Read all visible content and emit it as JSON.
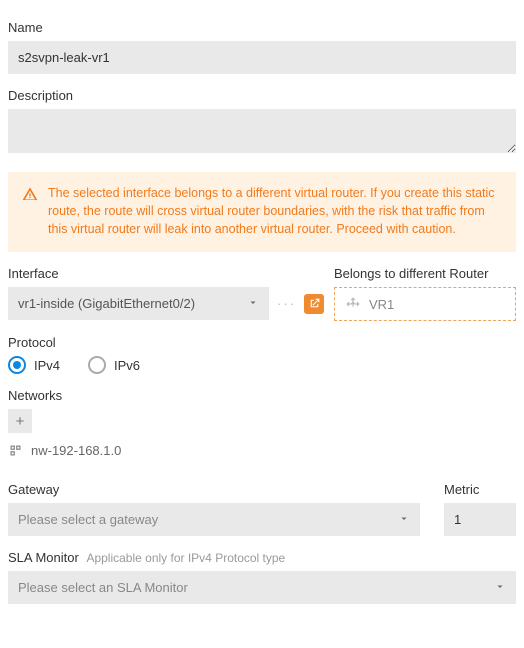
{
  "labels": {
    "name": "Name",
    "description": "Description",
    "interface": "Interface",
    "belongs": "Belongs to different Router",
    "protocol": "Protocol",
    "networks": "Networks",
    "gateway": "Gateway",
    "metric": "Metric",
    "sla": "SLA Monitor",
    "sla_hint": "Applicable only for IPv4 Protocol type"
  },
  "values": {
    "name": "s2svpn-leak-vr1",
    "description": "",
    "interface_selected": "vr1-inside (GigabitEthernet0/2)",
    "router_name": "VR1",
    "gateway_placeholder": "Please select a gateway",
    "metric": "1",
    "sla_placeholder": "Please select an SLA Monitor"
  },
  "protocol": {
    "ipv4": "IPv4",
    "ipv6": "IPv6",
    "selected": "ipv4"
  },
  "networks_list": [
    "nw-192-168.1.0"
  ],
  "alert": "The selected interface belongs to a different virtual router. If you create this static route, the route will cross virtual router boundaries, with the risk that traffic from this virtual router will leak into another virtual router. Proceed with caution."
}
